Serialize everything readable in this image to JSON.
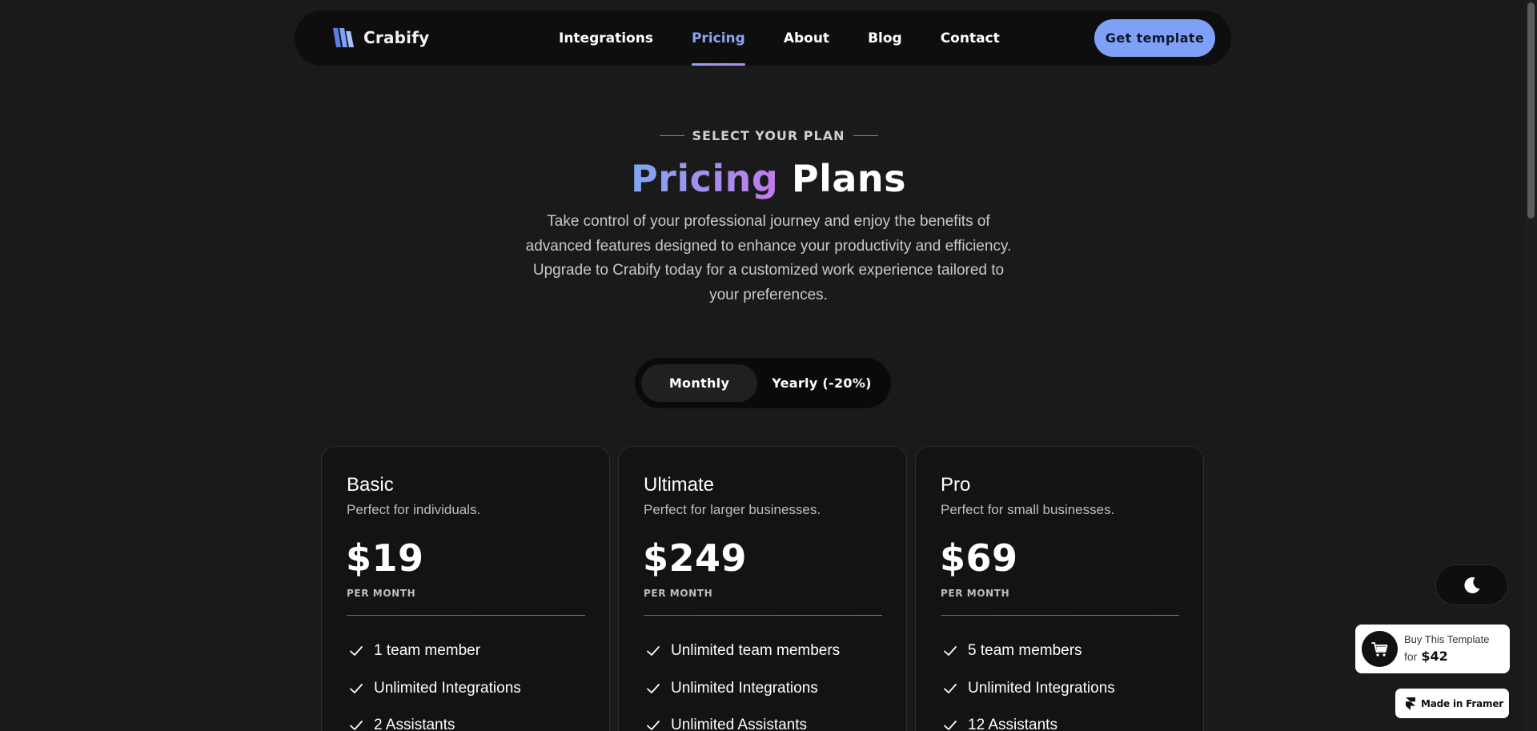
{
  "brand": {
    "name": "Crabify",
    "logo_icon": "crabify-logo-icon",
    "accent_color": "#7ea1f7",
    "gradient_from": "#7fa6f6",
    "gradient_to": "#c27ae8"
  },
  "nav": {
    "links": [
      {
        "label": "Integrations",
        "active": false
      },
      {
        "label": "Pricing",
        "active": true
      },
      {
        "label": "About",
        "active": false
      },
      {
        "label": "Blog",
        "active": false
      },
      {
        "label": "Contact",
        "active": false
      }
    ],
    "cta_label": "Get template"
  },
  "hero": {
    "eyebrow": "SELECT YOUR PLAN",
    "title_accent": "Pricing",
    "title_rest": "Plans",
    "description": "Take control of your professional journey and enjoy the benefits of advanced features designed to enhance your productivity and efficiency. Upgrade to Crabify today for a customized work experience tailored to your preferences."
  },
  "billing_toggle": {
    "selected": "Monthly",
    "options": [
      "Monthly",
      "Yearly (-20%)"
    ]
  },
  "plans": [
    {
      "name": "Basic",
      "subtitle": "Perfect for individuals.",
      "price": "$19",
      "period": "PER MONTH",
      "features": [
        "1 team member",
        "Unlimited Integrations",
        "2 Assistants"
      ]
    },
    {
      "name": "Ultimate",
      "subtitle": "Perfect for larger businesses.",
      "price": "$249",
      "period": "PER MONTH",
      "features": [
        "Unlimited team members",
        "Unlimited Integrations",
        "Unlimited Assistants"
      ]
    },
    {
      "name": "Pro",
      "subtitle": "Perfect for small businesses.",
      "price": "$69",
      "period": "PER MONTH",
      "features": [
        "5 team members",
        "Unlimited Integrations",
        "12 Assistants"
      ]
    }
  ],
  "theme_toggle": {
    "icon": "moon-icon"
  },
  "buy_template": {
    "icon": "cart-icon",
    "line1": "Buy This Template",
    "for_label": "for",
    "price": "$42"
  },
  "framer_badge": {
    "icon": "framer-icon",
    "label": "Made in Framer"
  }
}
